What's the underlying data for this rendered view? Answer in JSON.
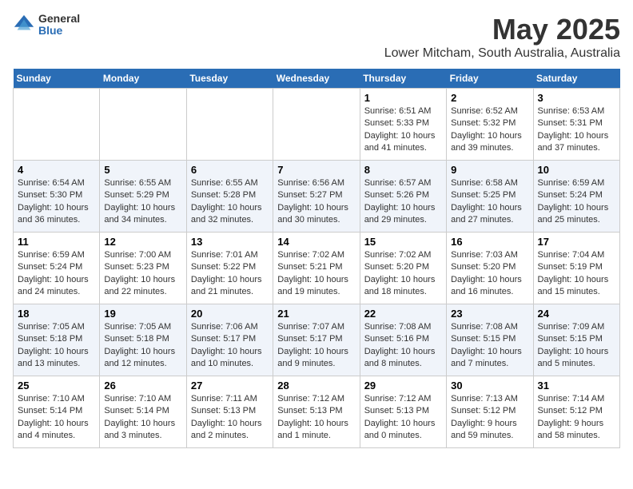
{
  "logo": {
    "general": "General",
    "blue": "Blue"
  },
  "title": "May 2025",
  "subtitle": "Lower Mitcham, South Australia, Australia",
  "days_header": [
    "Sunday",
    "Monday",
    "Tuesday",
    "Wednesday",
    "Thursday",
    "Friday",
    "Saturday"
  ],
  "weeks": [
    {
      "cells": [
        {
          "day": "",
          "info": ""
        },
        {
          "day": "",
          "info": ""
        },
        {
          "day": "",
          "info": ""
        },
        {
          "day": "",
          "info": ""
        },
        {
          "day": "1",
          "info": "Sunrise: 6:51 AM\nSunset: 5:33 PM\nDaylight: 10 hours\nand 41 minutes."
        },
        {
          "day": "2",
          "info": "Sunrise: 6:52 AM\nSunset: 5:32 PM\nDaylight: 10 hours\nand 39 minutes."
        },
        {
          "day": "3",
          "info": "Sunrise: 6:53 AM\nSunset: 5:31 PM\nDaylight: 10 hours\nand 37 minutes."
        }
      ]
    },
    {
      "cells": [
        {
          "day": "4",
          "info": "Sunrise: 6:54 AM\nSunset: 5:30 PM\nDaylight: 10 hours\nand 36 minutes."
        },
        {
          "day": "5",
          "info": "Sunrise: 6:55 AM\nSunset: 5:29 PM\nDaylight: 10 hours\nand 34 minutes."
        },
        {
          "day": "6",
          "info": "Sunrise: 6:55 AM\nSunset: 5:28 PM\nDaylight: 10 hours\nand 32 minutes."
        },
        {
          "day": "7",
          "info": "Sunrise: 6:56 AM\nSunset: 5:27 PM\nDaylight: 10 hours\nand 30 minutes."
        },
        {
          "day": "8",
          "info": "Sunrise: 6:57 AM\nSunset: 5:26 PM\nDaylight: 10 hours\nand 29 minutes."
        },
        {
          "day": "9",
          "info": "Sunrise: 6:58 AM\nSunset: 5:25 PM\nDaylight: 10 hours\nand 27 minutes."
        },
        {
          "day": "10",
          "info": "Sunrise: 6:59 AM\nSunset: 5:24 PM\nDaylight: 10 hours\nand 25 minutes."
        }
      ]
    },
    {
      "cells": [
        {
          "day": "11",
          "info": "Sunrise: 6:59 AM\nSunset: 5:24 PM\nDaylight: 10 hours\nand 24 minutes."
        },
        {
          "day": "12",
          "info": "Sunrise: 7:00 AM\nSunset: 5:23 PM\nDaylight: 10 hours\nand 22 minutes."
        },
        {
          "day": "13",
          "info": "Sunrise: 7:01 AM\nSunset: 5:22 PM\nDaylight: 10 hours\nand 21 minutes."
        },
        {
          "day": "14",
          "info": "Sunrise: 7:02 AM\nSunset: 5:21 PM\nDaylight: 10 hours\nand 19 minutes."
        },
        {
          "day": "15",
          "info": "Sunrise: 7:02 AM\nSunset: 5:20 PM\nDaylight: 10 hours\nand 18 minutes."
        },
        {
          "day": "16",
          "info": "Sunrise: 7:03 AM\nSunset: 5:20 PM\nDaylight: 10 hours\nand 16 minutes."
        },
        {
          "day": "17",
          "info": "Sunrise: 7:04 AM\nSunset: 5:19 PM\nDaylight: 10 hours\nand 15 minutes."
        }
      ]
    },
    {
      "cells": [
        {
          "day": "18",
          "info": "Sunrise: 7:05 AM\nSunset: 5:18 PM\nDaylight: 10 hours\nand 13 minutes."
        },
        {
          "day": "19",
          "info": "Sunrise: 7:05 AM\nSunset: 5:18 PM\nDaylight: 10 hours\nand 12 minutes."
        },
        {
          "day": "20",
          "info": "Sunrise: 7:06 AM\nSunset: 5:17 PM\nDaylight: 10 hours\nand 10 minutes."
        },
        {
          "day": "21",
          "info": "Sunrise: 7:07 AM\nSunset: 5:17 PM\nDaylight: 10 hours\nand 9 minutes."
        },
        {
          "day": "22",
          "info": "Sunrise: 7:08 AM\nSunset: 5:16 PM\nDaylight: 10 hours\nand 8 minutes."
        },
        {
          "day": "23",
          "info": "Sunrise: 7:08 AM\nSunset: 5:15 PM\nDaylight: 10 hours\nand 7 minutes."
        },
        {
          "day": "24",
          "info": "Sunrise: 7:09 AM\nSunset: 5:15 PM\nDaylight: 10 hours\nand 5 minutes."
        }
      ]
    },
    {
      "cells": [
        {
          "day": "25",
          "info": "Sunrise: 7:10 AM\nSunset: 5:14 PM\nDaylight: 10 hours\nand 4 minutes."
        },
        {
          "day": "26",
          "info": "Sunrise: 7:10 AM\nSunset: 5:14 PM\nDaylight: 10 hours\nand 3 minutes."
        },
        {
          "day": "27",
          "info": "Sunrise: 7:11 AM\nSunset: 5:13 PM\nDaylight: 10 hours\nand 2 minutes."
        },
        {
          "day": "28",
          "info": "Sunrise: 7:12 AM\nSunset: 5:13 PM\nDaylight: 10 hours\nand 1 minute."
        },
        {
          "day": "29",
          "info": "Sunrise: 7:12 AM\nSunset: 5:13 PM\nDaylight: 10 hours\nand 0 minutes."
        },
        {
          "day": "30",
          "info": "Sunrise: 7:13 AM\nSunset: 5:12 PM\nDaylight: 9 hours\nand 59 minutes."
        },
        {
          "day": "31",
          "info": "Sunrise: 7:14 AM\nSunset: 5:12 PM\nDaylight: 9 hours\nand 58 minutes."
        }
      ]
    }
  ]
}
